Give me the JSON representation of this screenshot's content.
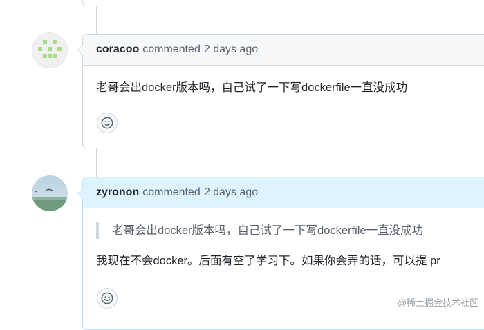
{
  "comments": [
    {
      "author": "coracoo",
      "action": "commented",
      "time": "2 days ago",
      "avatar_icon": "identicon-avatar",
      "quote": "",
      "body": "老哥会出docker版本吗，自己试了一下写dockerfile一直没成功",
      "reaction_icon": "smiley-icon"
    },
    {
      "author": "zyronon",
      "action": "commented",
      "time": "2 days ago",
      "avatar_icon": "landscape-photo-avatar",
      "quote": "老哥会出docker版本吗，自己试了一下写dockerfile一直没成功",
      "body": "我现在不会docker。后面有空了学习下。如果你会弄的话，可以提 pr",
      "reaction_icon": "smiley-icon"
    }
  ],
  "watermark": "@稀土掘金技术社区",
  "colors": {
    "border": "#d0d7de",
    "header_bg": "#f6f8fa",
    "author_header_bg": "#ddf4ff",
    "author_border": "#b6e3ff",
    "identicon": "#a6dd8b"
  }
}
